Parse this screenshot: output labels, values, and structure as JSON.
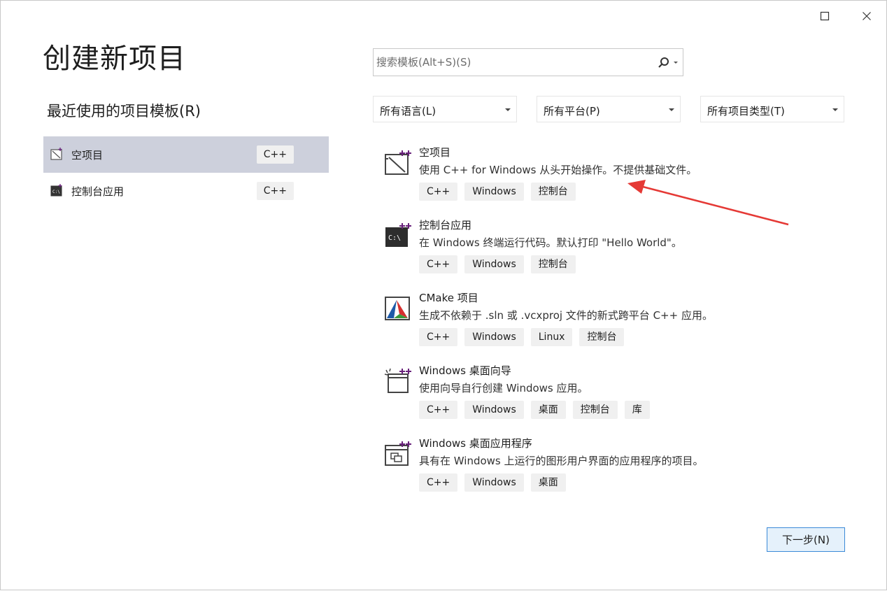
{
  "page": {
    "title": "创建新项目"
  },
  "recent": {
    "heading": "最近使用的项目模板(R)",
    "items": [
      {
        "label": "空项目",
        "tag": "C++",
        "icon": "empty-project-icon",
        "selected": true
      },
      {
        "label": "控制台应用",
        "tag": "C++",
        "icon": "console-app-icon",
        "selected": false
      }
    ]
  },
  "search": {
    "placeholder": "搜索模板(Alt+S)(S)",
    "value": ""
  },
  "filters": {
    "language": "所有语言(L)",
    "platform": "所有平台(P)",
    "project_type": "所有项目类型(T)"
  },
  "templates": [
    {
      "name": "空项目",
      "description": "使用 C++ for Windows 从头开始操作。不提供基础文件。",
      "icon": "empty-project-icon",
      "tags": [
        "C++",
        "Windows",
        "控制台"
      ]
    },
    {
      "name": "控制台应用",
      "description": "在 Windows 终端运行代码。默认打印 \"Hello World\"。",
      "icon": "console-app-icon",
      "tags": [
        "C++",
        "Windows",
        "控制台"
      ]
    },
    {
      "name": "CMake 项目",
      "description": "生成不依赖于 .sln 或 .vcxproj 文件的新式跨平台 C++ 应用。",
      "icon": "cmake-icon",
      "tags": [
        "C++",
        "Windows",
        "Linux",
        "控制台"
      ]
    },
    {
      "name": "Windows 桌面向导",
      "description": "使用向导自行创建 Windows 应用。",
      "icon": "desktop-wizard-icon",
      "tags": [
        "C++",
        "Windows",
        "桌面",
        "控制台",
        "库"
      ]
    },
    {
      "name": "Windows 桌面应用程序",
      "description": "具有在 Windows 上运行的图形用户界面的应用程序的项目。",
      "icon": "desktop-app-icon",
      "tags": [
        "C++",
        "Windows",
        "桌面"
      ]
    }
  ],
  "footer": {
    "next_label": "下一步(N)"
  },
  "colors": {
    "selected_bg": "#cdd0dc",
    "tag_bg": "#f0f0f0",
    "accent_purple": "#68217a",
    "annotation_arrow": "#e53935",
    "next_border": "#3b8ad8"
  }
}
